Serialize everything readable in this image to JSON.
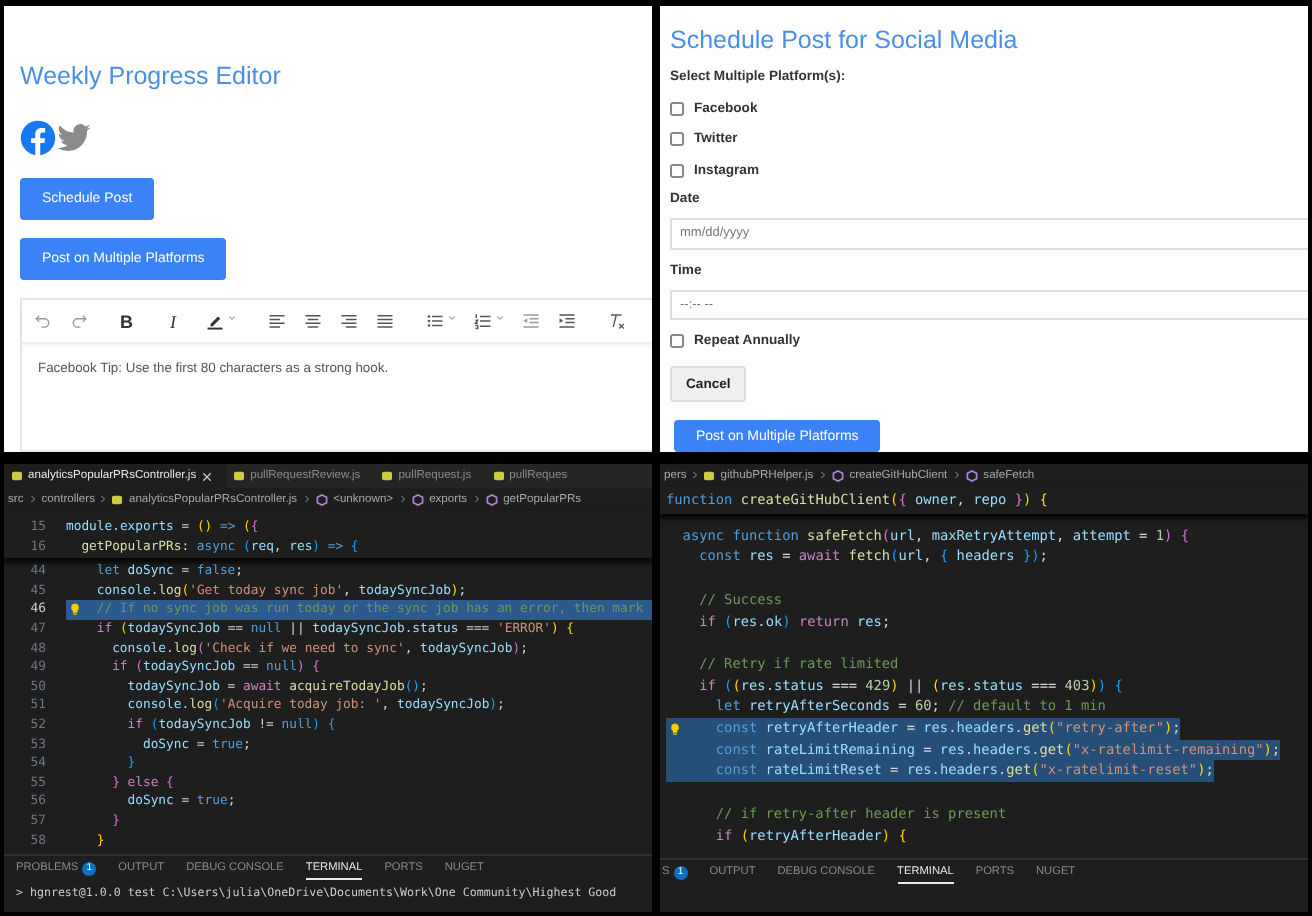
{
  "editor_panel": {
    "title": "Weekly Progress Editor",
    "social_icons": [
      {
        "kind": "facebook",
        "selected": true
      },
      {
        "kind": "twitter",
        "selected": false
      }
    ],
    "buttons": [
      "Schedule Post",
      "Post on Multiple Platforms"
    ],
    "toolbar": [
      {
        "kind": "undo"
      },
      {
        "kind": "redo"
      },
      {
        "kind": "bold",
        "label": "B"
      },
      {
        "kind": "italic",
        "label": "I"
      },
      {
        "kind": "highlight"
      },
      {
        "kind": "align-left"
      },
      {
        "kind": "align-center"
      },
      {
        "kind": "align-right"
      },
      {
        "kind": "justify"
      },
      {
        "kind": "bullet-list"
      },
      {
        "kind": "numbered-list"
      },
      {
        "kind": "outdent"
      },
      {
        "kind": "indent"
      },
      {
        "kind": "clear-format"
      }
    ],
    "content": "Facebook Tip: Use the first 80 characters as a strong hook."
  },
  "schedule_panel": {
    "title": "Schedule Post for Social Media",
    "platforms_label": "Select Multiple Platform(s):",
    "platforms": [
      {
        "label": "Facebook",
        "checked": false
      },
      {
        "label": "Twitter",
        "checked": false
      },
      {
        "label": "Instagram",
        "checked": false
      }
    ],
    "date_label": "Date",
    "date_placeholder": "mm/dd/yyyy",
    "time_label": "Time",
    "time_placeholder": "--:-- --",
    "repeat": {
      "label": "Repeat Annually",
      "checked": false
    },
    "cancel_button": "Cancel",
    "submit_button": "Post on Multiple Platforms"
  },
  "code_panels": [
    {
      "file_tabs": [
        {
          "label": "analyticsPopularPRsController.js",
          "selected": true
        },
        {
          "label": "pullRequestReview.js",
          "selected": false
        },
        {
          "label": "pullRequest.js",
          "selected": false
        },
        {
          "label": "pullReques",
          "selected": false
        }
      ],
      "breadcrumb": [
        {
          "kind": "folder",
          "label": "src"
        },
        {
          "kind": "folder",
          "label": "controllers"
        },
        {
          "kind": "file",
          "label": "analyticsPopularPRsController.js"
        },
        {
          "kind": "symbol",
          "label": "<unknown>"
        },
        {
          "kind": "symbol",
          "label": "exports"
        },
        {
          "kind": "symbol",
          "label": "getPopularPRs"
        }
      ],
      "sticky_lines": [
        {
          "number": "15",
          "tokens": [
            {
              "kind": "v",
              "text": "module"
            },
            {
              "kind": "p",
              "text": "."
            },
            {
              "kind": "v",
              "text": "exports"
            },
            {
              "kind": "p",
              "text": " = "
            },
            {
              "kind": "b",
              "text": "()"
            },
            {
              "kind": "k",
              "text": " =>"
            },
            {
              "kind": "b",
              "text": " ("
            },
            {
              "kind": "b2",
              "text": "{"
            }
          ]
        },
        {
          "number": "16",
          "tokens": [
            {
              "kind": "f",
              "text": "  getPopularPRs"
            },
            {
              "kind": "p",
              "text": ": "
            },
            {
              "kind": "k",
              "text": "async"
            },
            {
              "kind": "b3",
              "text": " ("
            },
            {
              "kind": "v",
              "text": "req"
            },
            {
              "kind": "p",
              "text": ", "
            },
            {
              "kind": "v",
              "text": "res"
            },
            {
              "kind": "b3",
              "text": ")"
            },
            {
              "kind": "k",
              "text": " =>"
            },
            {
              "kind": "b3",
              "text": " {"
            }
          ]
        }
      ],
      "lines": [
        {
          "number": "44",
          "highlighted": false,
          "selected": false,
          "lightbulb": false,
          "tokens": [
            {
              "kind": "k",
              "text": "    let"
            },
            {
              "kind": "v",
              "text": " doSync"
            },
            {
              "kind": "p",
              "text": " = "
            },
            {
              "kind": "k",
              "text": "false"
            },
            {
              "kind": "p",
              "text": ";"
            }
          ]
        },
        {
          "number": "45",
          "highlighted": false,
          "selected": false,
          "lightbulb": false,
          "tokens": [
            {
              "kind": "v",
              "text": "    console"
            },
            {
              "kind": "p",
              "text": "."
            },
            {
              "kind": "f",
              "text": "log"
            },
            {
              "kind": "b",
              "text": "("
            },
            {
              "kind": "s",
              "text": "'Get today sync job'"
            },
            {
              "kind": "p",
              "text": ", "
            },
            {
              "kind": "v",
              "text": "todaySyncJob"
            },
            {
              "kind": "b",
              "text": ")"
            },
            {
              "kind": "p",
              "text": ";"
            }
          ]
        },
        {
          "number": "46",
          "highlighted": true,
          "selected": false,
          "lightbulb": true,
          "tokens": [
            {
              "kind": "m",
              "text": "    // If no sync job was run today or the sync job has an error, then mark"
            }
          ]
        },
        {
          "number": "47",
          "highlighted": false,
          "selected": false,
          "lightbulb": false,
          "tokens": [
            {
              "kind": "c",
              "text": "    if"
            },
            {
              "kind": "b",
              "text": " ("
            },
            {
              "kind": "v",
              "text": "todaySyncJob"
            },
            {
              "kind": "p",
              "text": " == "
            },
            {
              "kind": "k",
              "text": "null"
            },
            {
              "kind": "p",
              "text": " || "
            },
            {
              "kind": "v",
              "text": "todaySyncJob"
            },
            {
              "kind": "p",
              "text": "."
            },
            {
              "kind": "v",
              "text": "status"
            },
            {
              "kind": "p",
              "text": " === "
            },
            {
              "kind": "s",
              "text": "'ERROR'"
            },
            {
              "kind": "b",
              "text": ")"
            },
            {
              "kind": "b",
              "text": " {"
            }
          ]
        },
        {
          "number": "48",
          "highlighted": false,
          "selected": false,
          "lightbulb": false,
          "tokens": [
            {
              "kind": "v",
              "text": "      console"
            },
            {
              "kind": "p",
              "text": "."
            },
            {
              "kind": "f",
              "text": "log"
            },
            {
              "kind": "b2",
              "text": "("
            },
            {
              "kind": "s",
              "text": "'Check if we need to sync'"
            },
            {
              "kind": "p",
              "text": ", "
            },
            {
              "kind": "v",
              "text": "todaySyncJob"
            },
            {
              "kind": "b2",
              "text": ")"
            },
            {
              "kind": "p",
              "text": ";"
            }
          ]
        },
        {
          "number": "49",
          "highlighted": false,
          "selected": false,
          "lightbulb": false,
          "tokens": [
            {
              "kind": "c",
              "text": "      if"
            },
            {
              "kind": "b2",
              "text": " ("
            },
            {
              "kind": "v",
              "text": "todaySyncJob"
            },
            {
              "kind": "p",
              "text": " == "
            },
            {
              "kind": "k",
              "text": "null"
            },
            {
              "kind": "b2",
              "text": ")"
            },
            {
              "kind": "b2",
              "text": " {"
            }
          ]
        },
        {
          "number": "50",
          "highlighted": false,
          "selected": false,
          "lightbulb": false,
          "tokens": [
            {
              "kind": "v",
              "text": "        todaySyncJob"
            },
            {
              "kind": "p",
              "text": " = "
            },
            {
              "kind": "c",
              "text": "await"
            },
            {
              "kind": "f",
              "text": " acquireTodayJob"
            },
            {
              "kind": "b3",
              "text": "()"
            },
            {
              "kind": "p",
              "text": ";"
            }
          ]
        },
        {
          "number": "51",
          "highlighted": false,
          "selected": false,
          "lightbulb": false,
          "tokens": [
            {
              "kind": "v",
              "text": "        console"
            },
            {
              "kind": "p",
              "text": "."
            },
            {
              "kind": "f",
              "text": "log"
            },
            {
              "kind": "b3",
              "text": "("
            },
            {
              "kind": "s",
              "text": "'Acquire today job: '"
            },
            {
              "kind": "p",
              "text": ", "
            },
            {
              "kind": "v",
              "text": "todaySyncJob"
            },
            {
              "kind": "b3",
              "text": ")"
            },
            {
              "kind": "p",
              "text": ";"
            }
          ]
        },
        {
          "number": "52",
          "highlighted": false,
          "selected": false,
          "lightbulb": false,
          "tokens": [
            {
              "kind": "c",
              "text": "        if"
            },
            {
              "kind": "b3",
              "text": " ("
            },
            {
              "kind": "v",
              "text": "todaySyncJob"
            },
            {
              "kind": "p",
              "text": " != "
            },
            {
              "kind": "k",
              "text": "null"
            },
            {
              "kind": "b3",
              "text": ")"
            },
            {
              "kind": "b3",
              "text": " {"
            }
          ]
        },
        {
          "number": "53",
          "highlighted": false,
          "selected": false,
          "lightbulb": false,
          "tokens": [
            {
              "kind": "v",
              "text": "          doSync"
            },
            {
              "kind": "p",
              "text": " = "
            },
            {
              "kind": "k",
              "text": "true"
            },
            {
              "kind": "p",
              "text": ";"
            }
          ]
        },
        {
          "number": "54",
          "highlighted": false,
          "selected": false,
          "lightbulb": false,
          "tokens": [
            {
              "kind": "b3",
              "text": "        }"
            }
          ]
        },
        {
          "number": "55",
          "highlighted": false,
          "selected": false,
          "lightbulb": false,
          "tokens": [
            {
              "kind": "b2",
              "text": "      }"
            },
            {
              "kind": "c",
              "text": " else"
            },
            {
              "kind": "b2",
              "text": " {"
            }
          ]
        },
        {
          "number": "56",
          "highlighted": false,
          "selected": false,
          "lightbulb": false,
          "tokens": [
            {
              "kind": "v",
              "text": "        doSync"
            },
            {
              "kind": "p",
              "text": " = "
            },
            {
              "kind": "k",
              "text": "true"
            },
            {
              "kind": "p",
              "text": ";"
            }
          ]
        },
        {
          "number": "57",
          "highlighted": false,
          "selected": false,
          "lightbulb": false,
          "tokens": [
            {
              "kind": "b2",
              "text": "      }"
            }
          ]
        },
        {
          "number": "58",
          "highlighted": false,
          "selected": false,
          "lightbulb": false,
          "tokens": [
            {
              "kind": "b",
              "text": "    }"
            }
          ]
        }
      ],
      "panel_tabs": [
        {
          "label": "PROBLEMS",
          "badge": "1",
          "selected": false
        },
        {
          "label": "OUTPUT",
          "selected": false
        },
        {
          "label": "DEBUG CONSOLE",
          "selected": false
        },
        {
          "label": "TERMINAL",
          "selected": true
        },
        {
          "label": "PORTS",
          "selected": false
        },
        {
          "label": "NUGET",
          "selected": false
        }
      ],
      "terminal_lines": [
        "> hgnrest@1.0.0 test C:\\Users\\julia\\OneDrive\\Documents\\Work\\One Community\\Highest Good"
      ]
    },
    {
      "breadcrumb": [
        {
          "kind": "folder",
          "label": "pers"
        },
        {
          "kind": "file",
          "label": "githubPRHelper.js"
        },
        {
          "kind": "symbol",
          "label": "createGitHubClient"
        },
        {
          "kind": "symbol",
          "label": "safeFetch"
        }
      ],
      "sticky_lines": [
        {
          "tokens": [
            {
              "kind": "k",
              "text": "function"
            },
            {
              "kind": "f",
              "text": " createGitHubClient"
            },
            {
              "kind": "b",
              "text": "("
            },
            {
              "kind": "b2",
              "text": "{"
            },
            {
              "kind": "v",
              "text": " owner"
            },
            {
              "kind": "p",
              "text": ", "
            },
            {
              "kind": "v",
              "text": "repo"
            },
            {
              "kind": "b2",
              "text": " }"
            },
            {
              "kind": "b",
              "text": ")"
            },
            {
              "kind": "b",
              "text": " {"
            }
          ]
        }
      ],
      "lines": [
        {
          "highlighted": false,
          "selected": false,
          "lightbulb": false,
          "gap_before": false,
          "tokens": [
            {
              "kind": "k",
              "text": "  async function"
            },
            {
              "kind": "f",
              "text": " safeFetch"
            },
            {
              "kind": "b2",
              "text": "("
            },
            {
              "kind": "v",
              "text": "url"
            },
            {
              "kind": "p",
              "text": ", "
            },
            {
              "kind": "v",
              "text": "maxRetryAttempt"
            },
            {
              "kind": "p",
              "text": ", "
            },
            {
              "kind": "v",
              "text": "attempt"
            },
            {
              "kind": "p",
              "text": " = "
            },
            {
              "kind": "n",
              "text": "1"
            },
            {
              "kind": "b2",
              "text": ")"
            },
            {
              "kind": "b2",
              "text": " {"
            }
          ]
        },
        {
          "highlighted": false,
          "selected": false,
          "lightbulb": false,
          "gap_before": false,
          "tokens": [
            {
              "kind": "k",
              "text": "    const"
            },
            {
              "kind": "v",
              "text": " res"
            },
            {
              "kind": "p",
              "text": " = "
            },
            {
              "kind": "c",
              "text": "await"
            },
            {
              "kind": "f",
              "text": " fetch"
            },
            {
              "kind": "b3",
              "text": "("
            },
            {
              "kind": "v",
              "text": "url"
            },
            {
              "kind": "p",
              "text": ", "
            },
            {
              "kind": "b3",
              "text": "{"
            },
            {
              "kind": "v",
              "text": " headers"
            },
            {
              "kind": "b3",
              "text": " })"
            },
            {
              "kind": "p",
              "text": ";"
            }
          ]
        },
        {
          "highlighted": false,
          "selected": false,
          "lightbulb": false,
          "gap_before": true,
          "tokens": [
            {
              "kind": "m",
              "text": "    // Success"
            }
          ]
        },
        {
          "highlighted": false,
          "selected": false,
          "lightbulb": false,
          "gap_before": false,
          "tokens": [
            {
              "kind": "c",
              "text": "    if"
            },
            {
              "kind": "b3",
              "text": " ("
            },
            {
              "kind": "v",
              "text": "res"
            },
            {
              "kind": "p",
              "text": "."
            },
            {
              "kind": "v",
              "text": "ok"
            },
            {
              "kind": "b3",
              "text": ")"
            },
            {
              "kind": "c",
              "text": " return"
            },
            {
              "kind": "v",
              "text": " res"
            },
            {
              "kind": "p",
              "text": ";"
            }
          ]
        },
        {
          "highlighted": false,
          "selected": false,
          "lightbulb": false,
          "gap_before": true,
          "tokens": [
            {
              "kind": "m",
              "text": "    // Retry if rate limited"
            }
          ]
        },
        {
          "highlighted": false,
          "selected": false,
          "lightbulb": false,
          "gap_before": false,
          "tokens": [
            {
              "kind": "c",
              "text": "    if"
            },
            {
              "kind": "b3",
              "text": " ("
            },
            {
              "kind": "b",
              "text": "("
            },
            {
              "kind": "v",
              "text": "res"
            },
            {
              "kind": "p",
              "text": "."
            },
            {
              "kind": "v",
              "text": "status"
            },
            {
              "kind": "p",
              "text": " === "
            },
            {
              "kind": "n",
              "text": "429"
            },
            {
              "kind": "b",
              "text": ")"
            },
            {
              "kind": "p",
              "text": " || "
            },
            {
              "kind": "b",
              "text": "("
            },
            {
              "kind": "v",
              "text": "res"
            },
            {
              "kind": "p",
              "text": "."
            },
            {
              "kind": "v",
              "text": "status"
            },
            {
              "kind": "p",
              "text": " === "
            },
            {
              "kind": "n",
              "text": "403"
            },
            {
              "kind": "b",
              "text": ")"
            },
            {
              "kind": "b3",
              "text": ")"
            },
            {
              "kind": "b3",
              "text": " {"
            }
          ]
        },
        {
          "highlighted": false,
          "selected": false,
          "lightbulb": false,
          "gap_before": false,
          "tokens": [
            {
              "kind": "k",
              "text": "      let"
            },
            {
              "kind": "v",
              "text": " retryAfterSeconds"
            },
            {
              "kind": "p",
              "text": " = "
            },
            {
              "kind": "n",
              "text": "60"
            },
            {
              "kind": "p",
              "text": ";"
            },
            {
              "kind": "m",
              "text": " // default to 1 min"
            }
          ]
        },
        {
          "highlighted": false,
          "selected": true,
          "lightbulb": true,
          "gap_before": false,
          "tokens": [
            {
              "kind": "k",
              "text": "      const"
            },
            {
              "kind": "v",
              "text": " retryAfterHeader"
            },
            {
              "kind": "p",
              "text": " = "
            },
            {
              "kind": "v",
              "text": "res"
            },
            {
              "kind": "p",
              "text": "."
            },
            {
              "kind": "v",
              "text": "headers"
            },
            {
              "kind": "p",
              "text": "."
            },
            {
              "kind": "f",
              "text": "get"
            },
            {
              "kind": "b",
              "text": "("
            },
            {
              "kind": "s",
              "text": "\"retry-after\""
            },
            {
              "kind": "b",
              "text": ")"
            },
            {
              "kind": "p",
              "text": ";"
            }
          ]
        },
        {
          "highlighted": false,
          "selected": true,
          "lightbulb": false,
          "gap_before": false,
          "tokens": [
            {
              "kind": "k",
              "text": "      const"
            },
            {
              "kind": "v",
              "text": " rateLimitRemaining"
            },
            {
              "kind": "p",
              "text": " = "
            },
            {
              "kind": "v",
              "text": "res"
            },
            {
              "kind": "p",
              "text": "."
            },
            {
              "kind": "v",
              "text": "headers"
            },
            {
              "kind": "p",
              "text": "."
            },
            {
              "kind": "f",
              "text": "get"
            },
            {
              "kind": "b",
              "text": "("
            },
            {
              "kind": "s",
              "text": "\"x-ratelimit-remaining\""
            },
            {
              "kind": "b",
              "text": ")"
            },
            {
              "kind": "p",
              "text": ";"
            }
          ]
        },
        {
          "highlighted": false,
          "selected": true,
          "lightbulb": false,
          "gap_before": false,
          "tokens": [
            {
              "kind": "k",
              "text": "      const"
            },
            {
              "kind": "v",
              "text": " rateLimitReset"
            },
            {
              "kind": "p",
              "text": " = "
            },
            {
              "kind": "v",
              "text": "res"
            },
            {
              "kind": "p",
              "text": "."
            },
            {
              "kind": "v",
              "text": "headers"
            },
            {
              "kind": "p",
              "text": "."
            },
            {
              "kind": "f",
              "text": "get"
            },
            {
              "kind": "b",
              "text": "("
            },
            {
              "kind": "s",
              "text": "\"x-ratelimit-reset\""
            },
            {
              "kind": "b",
              "text": ")"
            },
            {
              "kind": "p",
              "text": ";"
            }
          ]
        },
        {
          "highlighted": false,
          "selected": false,
          "lightbulb": false,
          "gap_before": true,
          "tokens": [
            {
              "kind": "m",
              "text": "      // if retry-after header is present"
            }
          ]
        },
        {
          "highlighted": false,
          "selected": false,
          "lightbulb": false,
          "gap_before": false,
          "tokens": [
            {
              "kind": "c",
              "text": "      if"
            },
            {
              "kind": "b",
              "text": " ("
            },
            {
              "kind": "v",
              "text": "retryAfterHeader"
            },
            {
              "kind": "b",
              "text": ")"
            },
            {
              "kind": "b",
              "text": " {"
            }
          ]
        }
      ],
      "panel_tabs": [
        {
          "label": "S",
          "badge": "1",
          "selected": false
        },
        {
          "label": "OUTPUT",
          "selected": false
        },
        {
          "label": "DEBUG CONSOLE",
          "selected": false
        },
        {
          "label": "TERMINAL",
          "selected": true
        },
        {
          "label": "PORTS",
          "selected": false
        },
        {
          "label": "NUGET",
          "selected": false
        }
      ]
    }
  ]
}
